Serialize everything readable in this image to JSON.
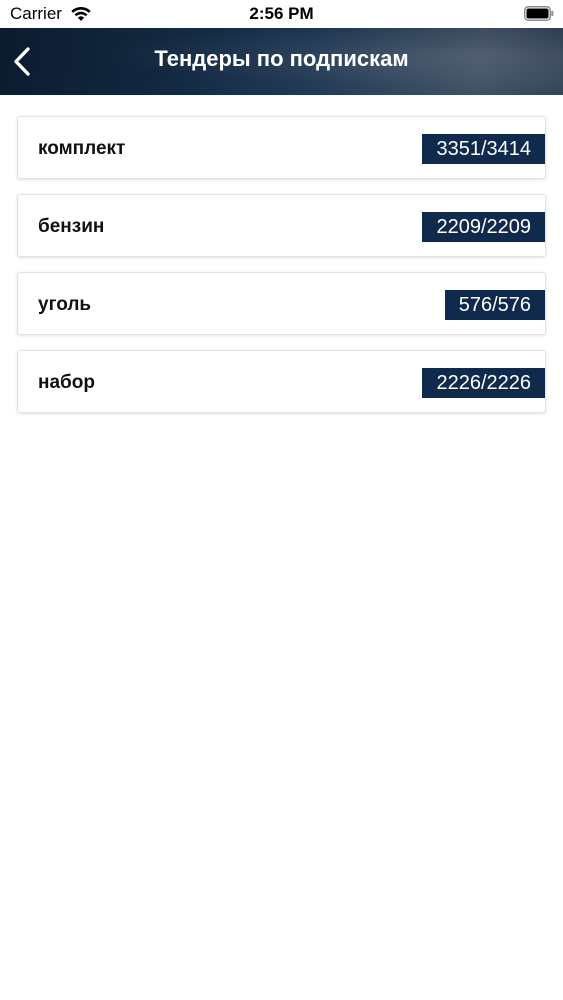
{
  "status_bar": {
    "carrier": "Carrier",
    "time": "2:56 PM"
  },
  "nav": {
    "title": "Тендеры по подпискам",
    "back_icon": "chevron-left-icon"
  },
  "subscriptions": [
    {
      "label": "комплект",
      "count": "3351/3414"
    },
    {
      "label": "бензин",
      "count": "2209/2209"
    },
    {
      "label": "уголь",
      "count": "576/576"
    },
    {
      "label": "набор",
      "count": "2226/2226"
    }
  ],
  "colors": {
    "badge_background": "#0f2a4c",
    "nav_background": "#142a44"
  }
}
